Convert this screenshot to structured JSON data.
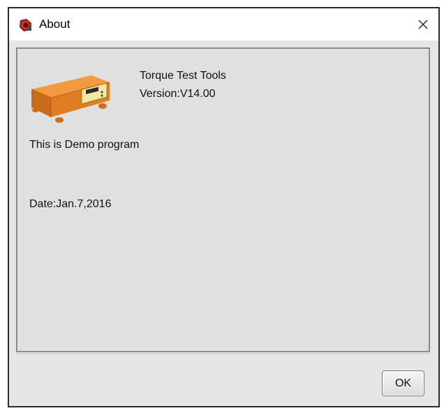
{
  "window": {
    "title": "About",
    "app_icon": "app-logo-icon",
    "close_icon": "close-icon"
  },
  "about": {
    "product_image": "torque-tester-device-image",
    "app_name": "Torque Test Tools",
    "version": "Version:V14.00",
    "demo_notice": "This is Demo program",
    "date": "Date:Jan.7,2016"
  },
  "buttons": {
    "ok_label": "OK"
  },
  "colors": {
    "device_body": "#e8862a",
    "device_panel": "#f3e9a6",
    "panel_border": "#8a8a8a",
    "window_bg": "#e6e6e6"
  }
}
